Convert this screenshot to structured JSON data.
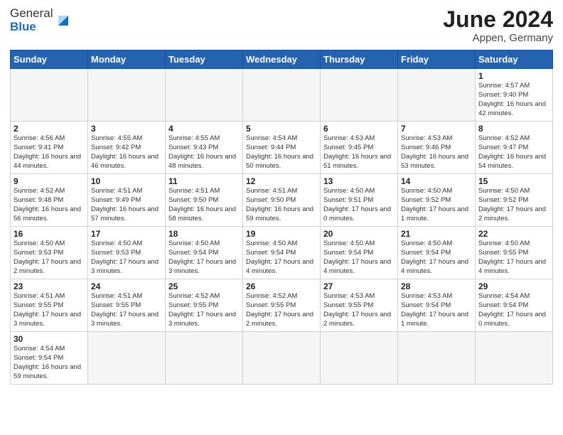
{
  "header": {
    "title": "June 2024",
    "location": "Appen, Germany",
    "logo_general": "General",
    "logo_blue": "Blue"
  },
  "days_of_week": [
    "Sunday",
    "Monday",
    "Tuesday",
    "Wednesday",
    "Thursday",
    "Friday",
    "Saturday"
  ],
  "weeks": [
    [
      {
        "day": "",
        "info": ""
      },
      {
        "day": "",
        "info": ""
      },
      {
        "day": "",
        "info": ""
      },
      {
        "day": "",
        "info": ""
      },
      {
        "day": "",
        "info": ""
      },
      {
        "day": "",
        "info": ""
      },
      {
        "day": "1",
        "info": "Sunrise: 4:57 AM\nSunset: 9:40 PM\nDaylight: 16 hours\nand 42 minutes."
      }
    ],
    [
      {
        "day": "2",
        "info": "Sunrise: 4:56 AM\nSunset: 9:41 PM\nDaylight: 16 hours\nand 44 minutes."
      },
      {
        "day": "3",
        "info": "Sunrise: 4:55 AM\nSunset: 9:42 PM\nDaylight: 16 hours\nand 46 minutes."
      },
      {
        "day": "4",
        "info": "Sunrise: 4:55 AM\nSunset: 9:43 PM\nDaylight: 16 hours\nand 48 minutes."
      },
      {
        "day": "5",
        "info": "Sunrise: 4:54 AM\nSunset: 9:44 PM\nDaylight: 16 hours\nand 50 minutes."
      },
      {
        "day": "6",
        "info": "Sunrise: 4:53 AM\nSunset: 9:45 PM\nDaylight: 16 hours\nand 51 minutes."
      },
      {
        "day": "7",
        "info": "Sunrise: 4:53 AM\nSunset: 9:46 PM\nDaylight: 16 hours\nand 53 minutes."
      },
      {
        "day": "8",
        "info": "Sunrise: 4:52 AM\nSunset: 9:47 PM\nDaylight: 16 hours\nand 54 minutes."
      }
    ],
    [
      {
        "day": "9",
        "info": "Sunrise: 4:52 AM\nSunset: 9:48 PM\nDaylight: 16 hours\nand 56 minutes."
      },
      {
        "day": "10",
        "info": "Sunrise: 4:51 AM\nSunset: 9:49 PM\nDaylight: 16 hours\nand 57 minutes."
      },
      {
        "day": "11",
        "info": "Sunrise: 4:51 AM\nSunset: 9:50 PM\nDaylight: 16 hours\nand 58 minutes."
      },
      {
        "day": "12",
        "info": "Sunrise: 4:51 AM\nSunset: 9:50 PM\nDaylight: 16 hours\nand 59 minutes."
      },
      {
        "day": "13",
        "info": "Sunrise: 4:50 AM\nSunset: 9:51 PM\nDaylight: 17 hours\nand 0 minutes."
      },
      {
        "day": "14",
        "info": "Sunrise: 4:50 AM\nSunset: 9:52 PM\nDaylight: 17 hours\nand 1 minute."
      },
      {
        "day": "15",
        "info": "Sunrise: 4:50 AM\nSunset: 9:52 PM\nDaylight: 17 hours\nand 2 minutes."
      }
    ],
    [
      {
        "day": "16",
        "info": "Sunrise: 4:50 AM\nSunset: 9:53 PM\nDaylight: 17 hours\nand 2 minutes."
      },
      {
        "day": "17",
        "info": "Sunrise: 4:50 AM\nSunset: 9:53 PM\nDaylight: 17 hours\nand 3 minutes."
      },
      {
        "day": "18",
        "info": "Sunrise: 4:50 AM\nSunset: 9:54 PM\nDaylight: 17 hours\nand 3 minutes."
      },
      {
        "day": "19",
        "info": "Sunrise: 4:50 AM\nSunset: 9:54 PM\nDaylight: 17 hours\nand 4 minutes."
      },
      {
        "day": "20",
        "info": "Sunrise: 4:50 AM\nSunset: 9:54 PM\nDaylight: 17 hours\nand 4 minutes."
      },
      {
        "day": "21",
        "info": "Sunrise: 4:50 AM\nSunset: 9:54 PM\nDaylight: 17 hours\nand 4 minutes."
      },
      {
        "day": "22",
        "info": "Sunrise: 4:50 AM\nSunset: 9:55 PM\nDaylight: 17 hours\nand 4 minutes."
      }
    ],
    [
      {
        "day": "23",
        "info": "Sunrise: 4:51 AM\nSunset: 9:55 PM\nDaylight: 17 hours\nand 3 minutes."
      },
      {
        "day": "24",
        "info": "Sunrise: 4:51 AM\nSunset: 9:55 PM\nDaylight: 17 hours\nand 3 minutes."
      },
      {
        "day": "25",
        "info": "Sunrise: 4:52 AM\nSunset: 9:55 PM\nDaylight: 17 hours\nand 3 minutes."
      },
      {
        "day": "26",
        "info": "Sunrise: 4:52 AM\nSunset: 9:55 PM\nDaylight: 17 hours\nand 2 minutes."
      },
      {
        "day": "27",
        "info": "Sunrise: 4:53 AM\nSunset: 9:55 PM\nDaylight: 17 hours\nand 2 minutes."
      },
      {
        "day": "28",
        "info": "Sunrise: 4:53 AM\nSunset: 9:54 PM\nDaylight: 17 hours\nand 1 minute."
      },
      {
        "day": "29",
        "info": "Sunrise: 4:54 AM\nSunset: 9:54 PM\nDaylight: 17 hours\nand 0 minutes."
      }
    ],
    [
      {
        "day": "30",
        "info": "Sunrise: 4:54 AM\nSunset: 9:54 PM\nDaylight: 16 hours\nand 59 minutes."
      },
      {
        "day": "",
        "info": ""
      },
      {
        "day": "",
        "info": ""
      },
      {
        "day": "",
        "info": ""
      },
      {
        "day": "",
        "info": ""
      },
      {
        "day": "",
        "info": ""
      },
      {
        "day": "",
        "info": ""
      }
    ]
  ]
}
